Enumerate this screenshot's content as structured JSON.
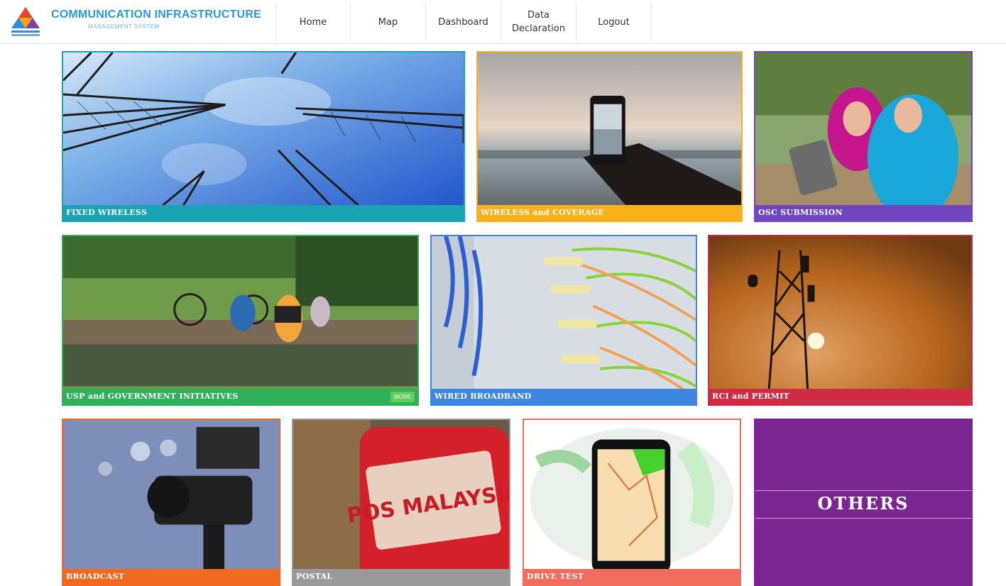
{
  "header": {
    "brand_title": "COMMUNICATION INFRASTRUCTURE",
    "brand_subtitle": "MANAGEMENT SYSTEM",
    "nav": [
      {
        "label": "Home"
      },
      {
        "label": "Map"
      },
      {
        "label": "Dashboard"
      },
      {
        "label": "Data Declaration"
      },
      {
        "label": "Logout"
      }
    ]
  },
  "tiles": {
    "fixed_wireless": {
      "label": "FIXED WIRELESS",
      "color": "#1aa3b3",
      "icon": "telecom-towers-photo"
    },
    "wireless_coverage": {
      "label": "WIRELESS and COVERAGE",
      "color": "#fbb11a",
      "icon": "smartphone-beach-photo"
    },
    "osc_submission": {
      "label": "OSC SUBMISSION",
      "color": "#6f45c2",
      "icon": "women-tablet-photo"
    },
    "usp_government": {
      "label": "USP and GOVERNMENT INITIATIVES",
      "color": "#2fb05a",
      "badge": "MORE",
      "icon": "children-laptop-bridge-photo"
    },
    "wired_broadband": {
      "label": "WIRED BROADBAND",
      "color": "#3d87e3",
      "icon": "fiber-cables-photo"
    },
    "rci_permit": {
      "label": "RCI and PERMIT",
      "color": "#cf2c43",
      "icon": "tower-sunset-photo"
    },
    "broadcast": {
      "label": "BROADCAST",
      "color": "#f26a21",
      "icon": "video-camera-photo"
    },
    "postal": {
      "label": "POSTAL",
      "color": "#9a9a9a",
      "icon": "pos-malaysia-postbox-photo"
    },
    "drive_test": {
      "label": "DRIVE TEST",
      "color": "#f06d5d",
      "icon": "phone-map-icon"
    },
    "others": {
      "label": "OTHERS",
      "color": "#7b2593"
    }
  },
  "postbox_text": "POS MALAYSIA"
}
